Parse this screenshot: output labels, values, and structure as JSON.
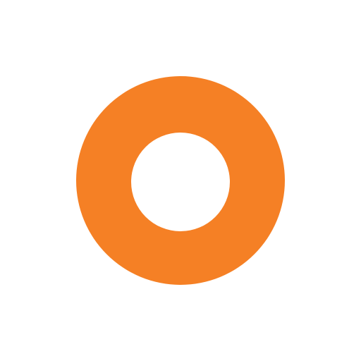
{
  "icon": {
    "name": "orange-ring-icon",
    "shape": "ring",
    "color": "#F58025",
    "background": "#FFFFFF"
  }
}
